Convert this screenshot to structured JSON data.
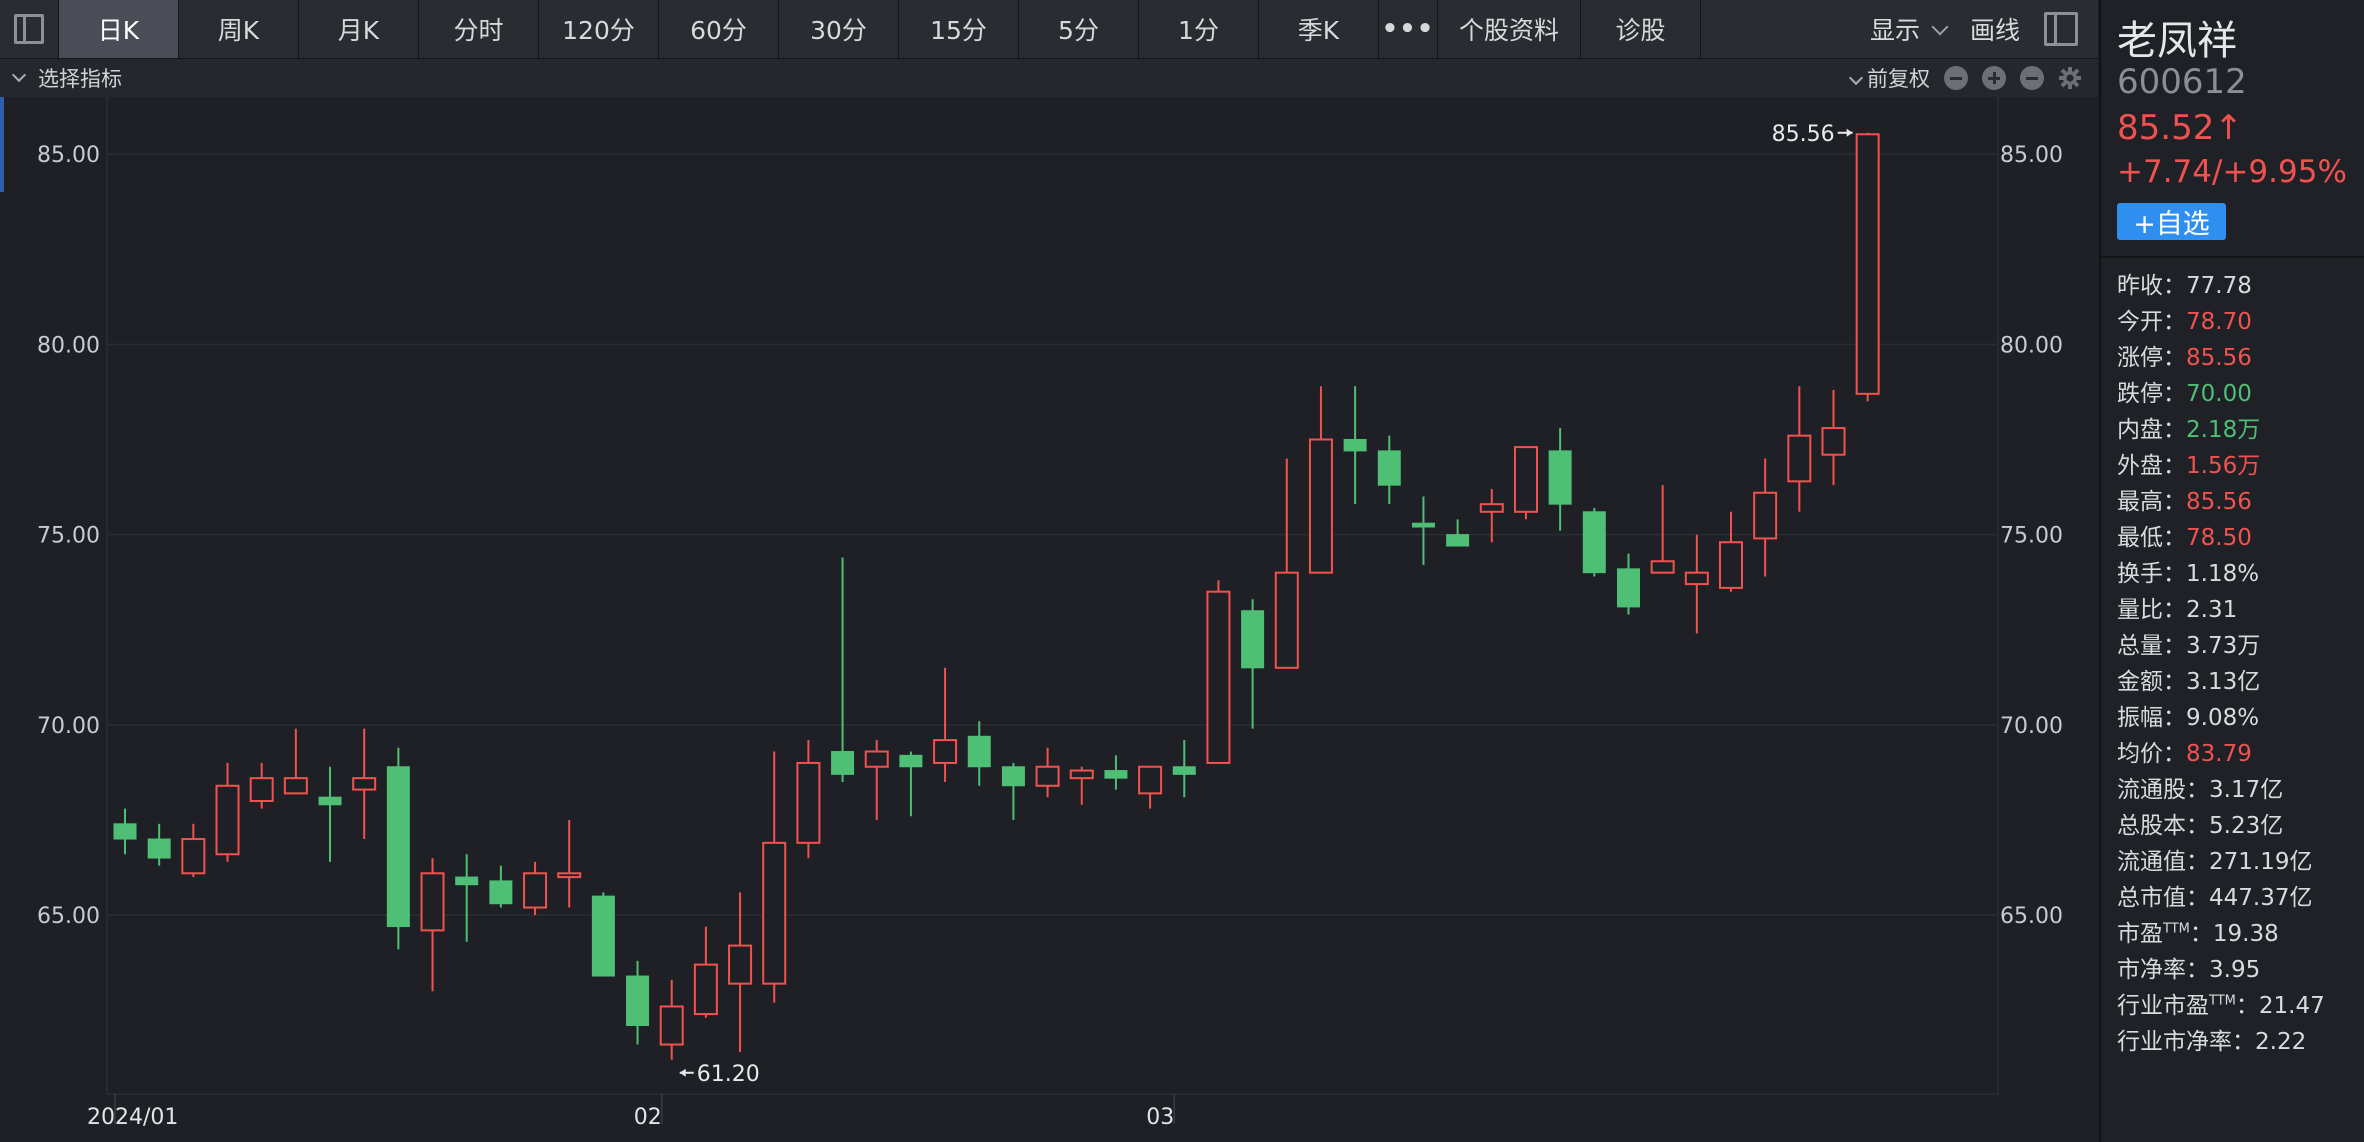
{
  "toolbar": {
    "tabs": [
      "日K",
      "周K",
      "月K",
      "分时",
      "120分",
      "60分",
      "30分",
      "15分",
      "5分",
      "1分",
      "季K"
    ],
    "more": "•••",
    "extra_tabs": [
      "个股资料",
      "诊股"
    ],
    "display_label": "显示",
    "draw_label": "画线"
  },
  "subheader": {
    "indicator_label": "选择指标",
    "adjust_label": "前复权"
  },
  "stock": {
    "name": "老凤祥",
    "code": "600612",
    "price": "85.52↑",
    "change": "+7.74/+9.95%",
    "watch_button": "+自选"
  },
  "stats": [
    {
      "label": "昨收：",
      "value": "77.78",
      "tone": "neutral"
    },
    {
      "label": "今开：",
      "value": "78.70",
      "tone": "red"
    },
    {
      "label": "涨停：",
      "value": "85.56",
      "tone": "red"
    },
    {
      "label": "跌停：",
      "value": "70.00",
      "tone": "green"
    },
    {
      "label": "内盘：",
      "value": "2.18万",
      "tone": "green"
    },
    {
      "label": "外盘：",
      "value": "1.56万",
      "tone": "red"
    },
    {
      "label": "最高：",
      "value": "85.56",
      "tone": "red"
    },
    {
      "label": "最低：",
      "value": "78.50",
      "tone": "red"
    },
    {
      "label": "换手：",
      "value": "1.18%",
      "tone": "neutral"
    },
    {
      "label": "量比：",
      "value": "2.31",
      "tone": "neutral"
    },
    {
      "label": "总量：",
      "value": "3.73万",
      "tone": "neutral"
    },
    {
      "label": "金额：",
      "value": "3.13亿",
      "tone": "neutral"
    },
    {
      "label": "振幅：",
      "value": "9.08%",
      "tone": "neutral"
    },
    {
      "label": "均价：",
      "value": "83.79",
      "tone": "red"
    },
    {
      "label": "流通股：",
      "value": "3.17亿",
      "tone": "neutral"
    },
    {
      "label": "总股本：",
      "value": "5.23亿",
      "tone": "neutral"
    },
    {
      "label": "流通值：",
      "value": "271.19亿",
      "tone": "neutral"
    },
    {
      "label": "总市值：",
      "value": "447.37亿",
      "tone": "neutral"
    },
    {
      "label": "市盈",
      "sup": "TTM",
      "label2": "：",
      "value": "19.38",
      "tone": "neutral"
    },
    {
      "label": "市净率：",
      "value": "3.95",
      "tone": "neutral"
    },
    {
      "label": "行业市盈",
      "sup": "TTM",
      "label2": "：",
      "value": "21.47",
      "tone": "neutral"
    },
    {
      "label": "行业市净率：",
      "value": "2.22",
      "tone": "neutral"
    }
  ],
  "colors": {
    "up": "#f0534f",
    "down": "#4fbf76",
    "grid": "#2b2d33",
    "text": "#c9cbd0"
  },
  "chart_data": {
    "type": "candlestick",
    "y_ticks": [
      "85.00",
      "80.00",
      "75.00",
      "70.00",
      "65.00"
    ],
    "ylim": [
      60.3,
      86.5
    ],
    "x_labels": [
      {
        "index": 0,
        "text": "2024/01"
      },
      {
        "index": 16,
        "text": "02"
      },
      {
        "index": 31,
        "text": "03"
      }
    ],
    "max_marker": {
      "index": 51,
      "value": 85.56,
      "text": "85.56"
    },
    "min_marker": {
      "index": 16,
      "value": 61.2,
      "text": "61.20"
    },
    "candles": [
      {
        "o": 67.4,
        "h": 67.8,
        "l": 66.6,
        "c": 67.0
      },
      {
        "o": 67.0,
        "h": 67.4,
        "l": 66.3,
        "c": 66.5
      },
      {
        "o": 66.1,
        "h": 67.4,
        "l": 66.0,
        "c": 67.0
      },
      {
        "o": 66.6,
        "h": 69.0,
        "l": 66.4,
        "c": 68.4
      },
      {
        "o": 68.0,
        "h": 69.0,
        "l": 67.8,
        "c": 68.6
      },
      {
        "o": 68.2,
        "h": 69.9,
        "l": 68.2,
        "c": 68.6
      },
      {
        "o": 68.1,
        "h": 68.9,
        "l": 66.4,
        "c": 67.9
      },
      {
        "o": 68.3,
        "h": 69.9,
        "l": 67.0,
        "c": 68.6
      },
      {
        "o": 68.9,
        "h": 69.4,
        "l": 64.1,
        "c": 64.7
      },
      {
        "o": 64.6,
        "h": 66.5,
        "l": 63.0,
        "c": 66.1
      },
      {
        "o": 66.0,
        "h": 66.6,
        "l": 64.3,
        "c": 65.8
      },
      {
        "o": 65.9,
        "h": 66.3,
        "l": 65.2,
        "c": 65.3
      },
      {
        "o": 65.2,
        "h": 66.4,
        "l": 65.0,
        "c": 66.1
      },
      {
        "o": 66.0,
        "h": 67.5,
        "l": 65.2,
        "c": 66.1
      },
      {
        "o": 65.5,
        "h": 65.6,
        "l": 63.4,
        "c": 63.4
      },
      {
        "o": 63.4,
        "h": 63.8,
        "l": 61.6,
        "c": 62.1
      },
      {
        "o": 61.6,
        "h": 63.3,
        "l": 61.2,
        "c": 62.6
      },
      {
        "o": 62.4,
        "h": 64.7,
        "l": 62.3,
        "c": 63.7
      },
      {
        "o": 63.2,
        "h": 65.6,
        "l": 61.4,
        "c": 64.2
      },
      {
        "o": 63.2,
        "h": 69.3,
        "l": 62.7,
        "c": 66.9
      },
      {
        "o": 66.9,
        "h": 69.6,
        "l": 66.5,
        "c": 69.0
      },
      {
        "o": 69.3,
        "h": 74.4,
        "l": 68.5,
        "c": 68.7
      },
      {
        "o": 68.9,
        "h": 69.6,
        "l": 67.5,
        "c": 69.3
      },
      {
        "o": 69.2,
        "h": 69.3,
        "l": 67.6,
        "c": 68.9
      },
      {
        "o": 69.0,
        "h": 71.5,
        "l": 68.5,
        "c": 69.6
      },
      {
        "o": 69.7,
        "h": 70.1,
        "l": 68.4,
        "c": 68.9
      },
      {
        "o": 68.9,
        "h": 69.0,
        "l": 67.5,
        "c": 68.4
      },
      {
        "o": 68.4,
        "h": 69.4,
        "l": 68.1,
        "c": 68.9
      },
      {
        "o": 68.6,
        "h": 68.9,
        "l": 67.9,
        "c": 68.8
      },
      {
        "o": 68.8,
        "h": 69.2,
        "l": 68.3,
        "c": 68.6
      },
      {
        "o": 68.2,
        "h": 68.9,
        "l": 67.8,
        "c": 68.9
      },
      {
        "o": 68.9,
        "h": 69.6,
        "l": 68.1,
        "c": 68.7
      },
      {
        "o": 69.0,
        "h": 73.8,
        "l": 69.0,
        "c": 73.5
      },
      {
        "o": 73.0,
        "h": 73.3,
        "l": 69.9,
        "c": 71.5
      },
      {
        "o": 71.5,
        "h": 77.0,
        "l": 71.5,
        "c": 74.0
      },
      {
        "o": 74.0,
        "h": 78.9,
        "l": 74.0,
        "c": 77.5
      },
      {
        "o": 77.5,
        "h": 78.9,
        "l": 75.8,
        "c": 77.2
      },
      {
        "o": 77.2,
        "h": 77.6,
        "l": 75.8,
        "c": 76.3
      },
      {
        "o": 75.3,
        "h": 76.0,
        "l": 74.2,
        "c": 75.2
      },
      {
        "o": 75.0,
        "h": 75.4,
        "l": 74.7,
        "c": 74.7
      },
      {
        "o": 75.6,
        "h": 76.2,
        "l": 74.8,
        "c": 75.8
      },
      {
        "o": 75.6,
        "h": 77.3,
        "l": 75.4,
        "c": 77.3
      },
      {
        "o": 77.2,
        "h": 77.8,
        "l": 75.1,
        "c": 75.8
      },
      {
        "o": 75.6,
        "h": 75.7,
        "l": 73.9,
        "c": 74.0
      },
      {
        "o": 74.1,
        "h": 74.5,
        "l": 72.9,
        "c": 73.1
      },
      {
        "o": 74.0,
        "h": 76.3,
        "l": 74.0,
        "c": 74.3
      },
      {
        "o": 73.7,
        "h": 75.0,
        "l": 72.4,
        "c": 74.0
      },
      {
        "o": 73.6,
        "h": 75.6,
        "l": 73.5,
        "c": 74.8
      },
      {
        "o": 74.9,
        "h": 77.0,
        "l": 73.9,
        "c": 76.1
      },
      {
        "o": 76.4,
        "h": 78.9,
        "l": 75.6,
        "c": 77.6
      },
      {
        "o": 77.1,
        "h": 78.8,
        "l": 76.3,
        "c": 77.8
      },
      {
        "o": 78.7,
        "h": 85.56,
        "l": 78.5,
        "c": 85.52
      }
    ]
  }
}
